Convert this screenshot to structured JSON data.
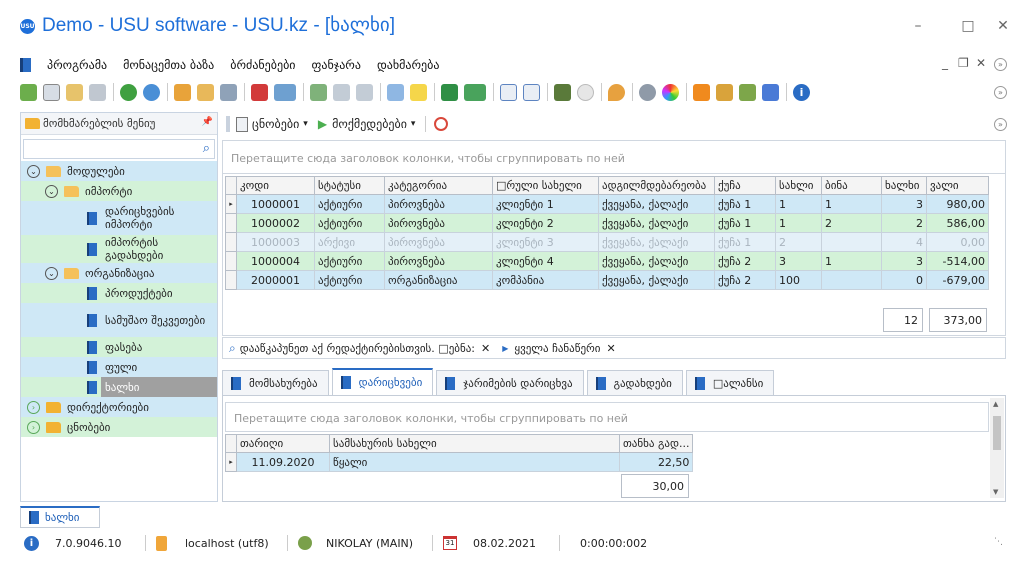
{
  "window": {
    "title": "Demo - USU software - USU.kz - [ხალხი]",
    "logo_text": "USU",
    "minimize": "–",
    "maximize": "□",
    "close": "✕"
  },
  "menu": {
    "items": [
      "პროგრამა",
      "მონაცემთა ბაზა",
      "ბრძანებები",
      "ფანჯარა",
      "დახმარება"
    ],
    "mdi_minimize": "_",
    "mdi_restore": "❐",
    "mdi_close": "✕"
  },
  "toolbar": {
    "icons": [
      "refresh-icon",
      "copy-icon",
      "edit-icon",
      "delete-icon",
      "sync-icon",
      "search-icon",
      "filter-icon",
      "filter-clear-icon",
      "filter-settings-icon",
      "flag-icon",
      "image-icon",
      "export-icon",
      "collapse-icon",
      "expand-icon",
      "add-child-icon",
      "note-icon",
      "excel-icon",
      "excel-export-icon",
      "window-new-icon",
      "window-close-icon",
      "exit-icon",
      "nav-icon",
      "location-icon",
      "settings-icon",
      "color-icon",
      "rss-icon",
      "lock-icon",
      "users-icon",
      "pin-icon",
      "info-icon"
    ]
  },
  "left_panel": {
    "header": "მომხმარებლის მენიუ",
    "pin": "📌",
    "tree": [
      {
        "label": "მოდულები",
        "level": 0,
        "type": "folder-open",
        "expander": "⊖"
      },
      {
        "label": "იმპორტი",
        "level": 1,
        "type": "folder-open",
        "expander": "⊖"
      },
      {
        "label": "დარიცხვების იმპორტი",
        "level": 2,
        "type": "book"
      },
      {
        "label": "იმპორტის გადახდები",
        "level": 2,
        "type": "book"
      },
      {
        "label": "ორგანიზაცია",
        "level": 1,
        "type": "folder-open",
        "expander": "⊖"
      },
      {
        "label": "პროდუქტები",
        "level": 2,
        "type": "book"
      },
      {
        "label": "სამუშაო შეკვეთები",
        "level": 2,
        "type": "book"
      },
      {
        "label": "ფასება",
        "level": 2,
        "type": "book"
      },
      {
        "label": "ფული",
        "level": 2,
        "type": "book"
      },
      {
        "label": "ხალხი",
        "level": 2,
        "type": "book",
        "selected": true
      },
      {
        "label": "დირექტორიები",
        "level": 0,
        "type": "folder",
        "expander": "⊕"
      },
      {
        "label": "ცნობები",
        "level": 0,
        "type": "folder",
        "expander": "⊕"
      }
    ]
  },
  "right_toolbar": {
    "reports": "ცნობები",
    "actions": "მოქმედებები",
    "dropdown": "▾"
  },
  "main_grid": {
    "group_hint": "Перетащите сюда заголовок колонки, чтобы сгруппировать по ней",
    "columns": [
      "კოდი",
      "სტატუსი",
      "კატეგორია",
      "□რული სახელი",
      "ადგილმდებარეობა",
      "ქუჩა",
      "სახლი",
      "ბინა",
      "ხალხი",
      "ვალი"
    ],
    "rows": [
      {
        "cells": [
          "1000001",
          "აქტიური",
          "პიროვნება",
          "კლიენტი 1",
          "ქვეყანა, ქალაქი",
          "ქუჩა 1",
          "1",
          "1",
          "3",
          "980,00"
        ],
        "color": "#cfe8f6",
        "marker": "▸"
      },
      {
        "cells": [
          "1000002",
          "აქტიური",
          "პიროვნება",
          "კლიენტი 2",
          "ქვეყანა, ქალაქი",
          "ქუჩა 1",
          "1",
          "2",
          "2",
          "586,00"
        ],
        "color": "#d3f2d8",
        "marker": ""
      },
      {
        "cells": [
          "1000003",
          "არქივი",
          "პიროვნება",
          "კლიენტი 3",
          "ქვეყანა, ქალაქი",
          "ქუჩა 1",
          "2",
          "",
          "4",
          "0,00"
        ],
        "color": "#e4f0f8",
        "marker": "",
        "faded": true
      },
      {
        "cells": [
          "1000004",
          "აქტიური",
          "პიროვნება",
          "კლიენტი 4",
          "ქვეყანა, ქალაქი",
          "ქუჩა 2",
          "3",
          "1",
          "3",
          "-514,00"
        ],
        "color": "#d3f2d8",
        "marker": ""
      },
      {
        "cells": [
          "2000001",
          "აქტიური",
          "ორგანიზაცია",
          "კომპანია",
          "ქვეყანა, ქალაქი",
          "ქუჩა 2",
          "100",
          "",
          "0",
          "-679,00"
        ],
        "color": "#cfe8f6",
        "marker": ""
      }
    ],
    "total_count": "12",
    "total_sum": "373,00"
  },
  "filter_bar": {
    "text": "დააწკაპუნეთ აქ რედაქტირებისთვის. □ებნა:",
    "all_records": "ყველა ჩანაწერი",
    "clear": "✕"
  },
  "tabs": [
    {
      "label": "მომსახურება",
      "active": false
    },
    {
      "label": "დარიცხვები",
      "active": true
    },
    {
      "label": "ჯარიმების დარიცხვა",
      "active": false
    },
    {
      "label": "გადახდები",
      "active": false
    },
    {
      "label": "□ალანსი",
      "active": false
    }
  ],
  "detail_grid": {
    "group_hint": "Перетащите сюда заголовок колонки, чтобы сгруппировать по ней",
    "columns": [
      "თარიღი",
      "სამსახურის სახელი",
      "თანხა გად..."
    ],
    "rows": [
      {
        "cells": [
          "11.09.2020",
          "წყალი",
          "22,50"
        ],
        "marker": "▸"
      }
    ],
    "total": "30,00"
  },
  "bottom_tab": "ხალხი",
  "status": {
    "version": "7.0.9046.10",
    "db": "localhost (utf8)",
    "user": "NIKOLAY (MAIN)",
    "calendar_day": "31",
    "date": "08.02.2021",
    "timer": "0:00:00:002"
  },
  "colors": {
    "accent": "#1e6fd9",
    "tree_selected": "#a0a0a0",
    "tree_row_blue": "#cfe8f6",
    "tree_row_green": "#d3f2d8"
  }
}
